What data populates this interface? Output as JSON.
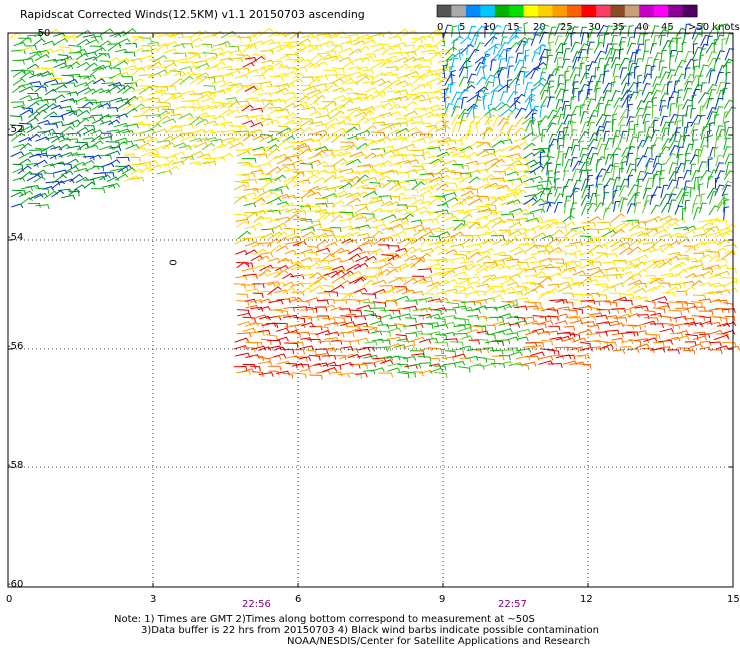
{
  "title": "Rapidscat Corrected Winds(12.5KM) v1.1 20150703 ascending",
  "legend": {
    "colors": [
      "#555555",
      "#aaaaaa",
      "#008cff",
      "#00c8ff",
      "#00b400",
      "#00e000",
      "#ffff00",
      "#ffd000",
      "#ff9c00",
      "#ff6000",
      "#ff0000",
      "#ff3c64",
      "#8c4b28",
      "#c8a078",
      "#c800c8",
      "#ff00ff",
      "#8c0096",
      "#500064"
    ],
    "labels": [
      "0",
      "5",
      "10",
      "15",
      "20",
      "25",
      "30",
      "35",
      "40",
      "45",
      ">50 knots"
    ]
  },
  "axes": {
    "x_ticks": [
      "0",
      "3",
      "6",
      "9",
      "12",
      "15"
    ],
    "y_ticks": [
      "-50",
      "-52",
      "-54",
      "-56",
      "-58",
      "-60"
    ]
  },
  "times": [
    "22:56",
    "22:57"
  ],
  "marker": "0",
  "notes": [
    "Note: 1) Times are GMT 2)Times along bottom correspond to measurement at ~50S",
    "3)Data buffer is 22 hrs from 20150703 4) Black wind barbs indicate possible contamination",
    "NOAA/NESDIS/Center for Satellite Applications and Research"
  ]
}
